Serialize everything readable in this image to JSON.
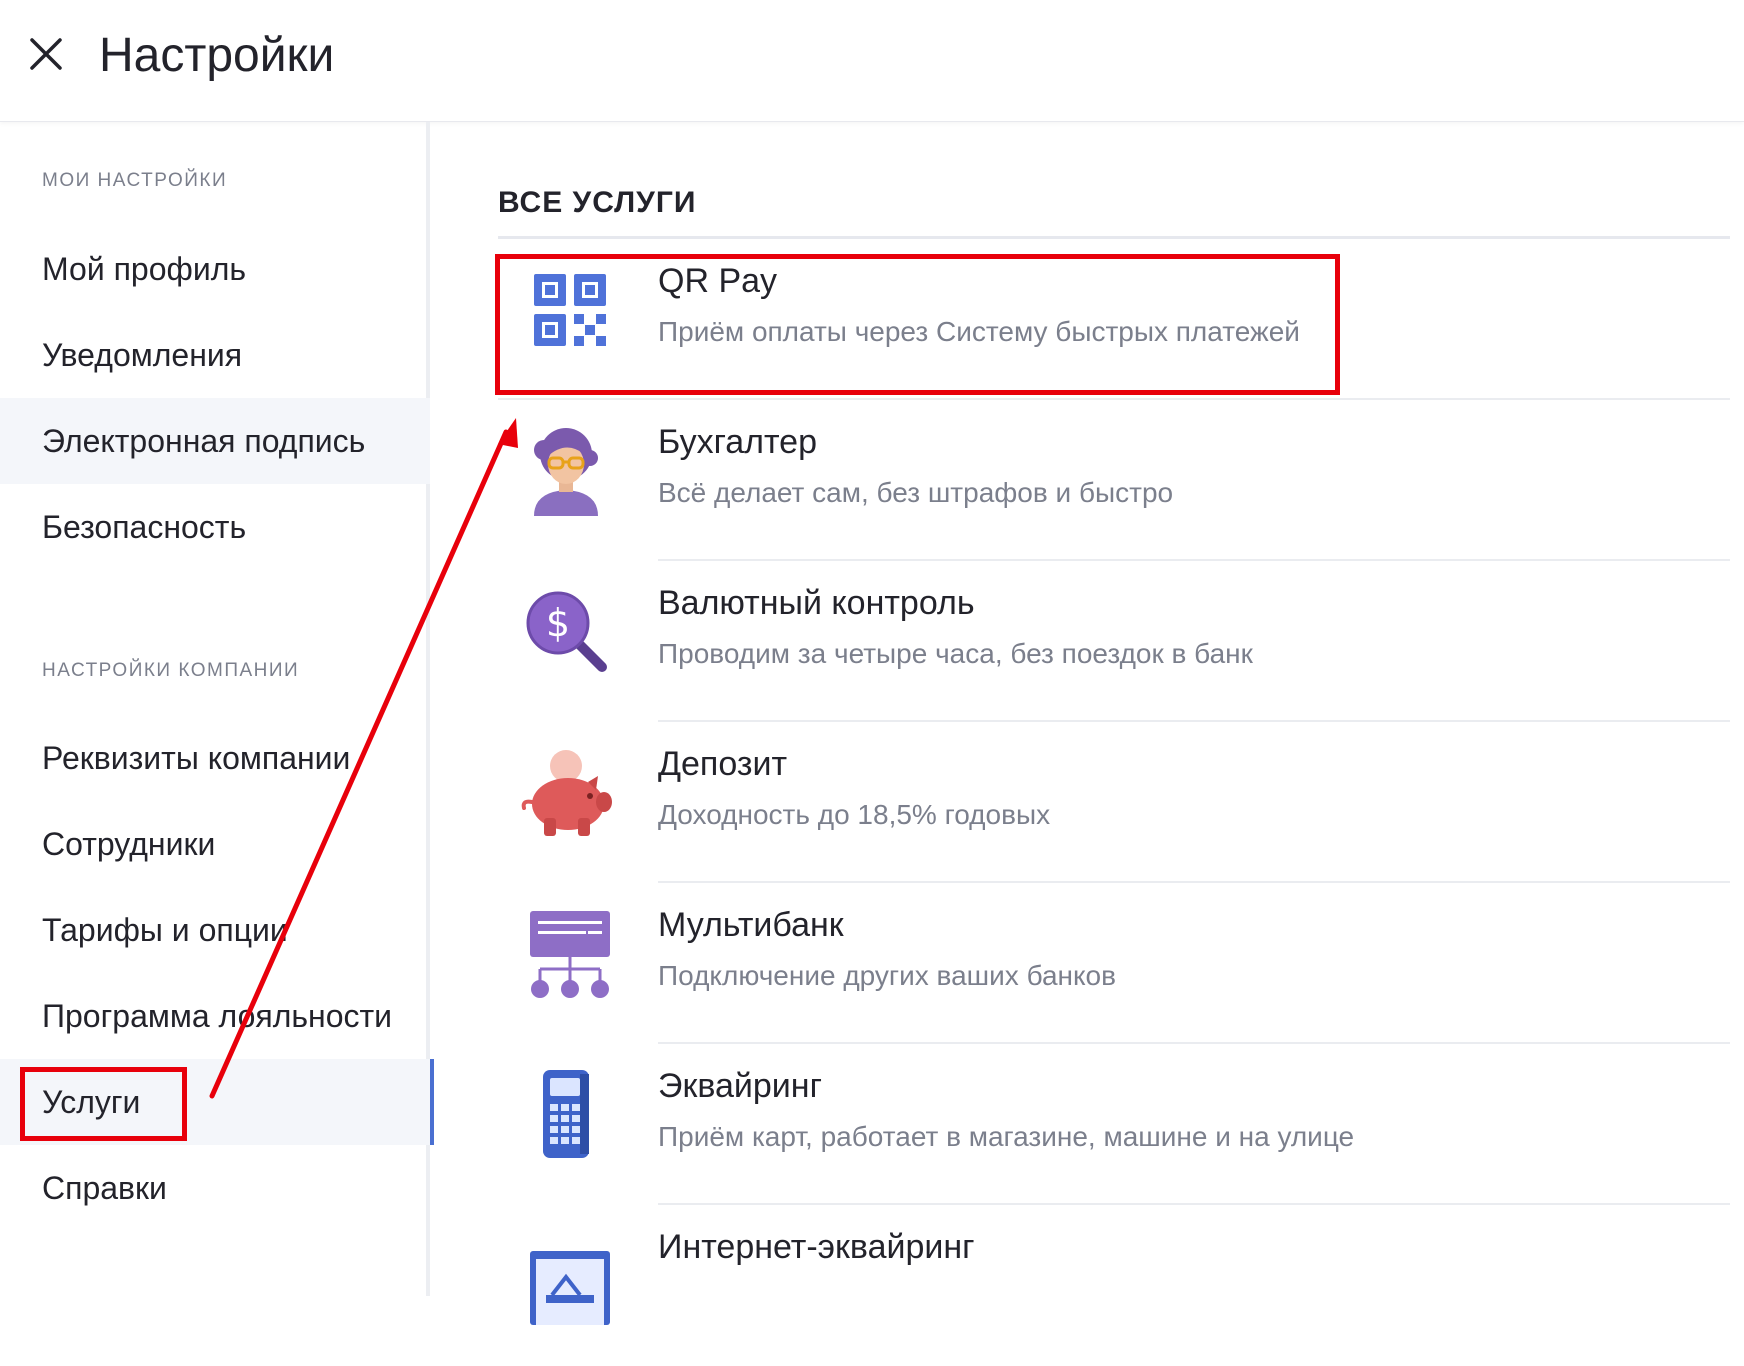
{
  "header": {
    "title": "Настройки"
  },
  "sidebar": {
    "my_section_label": "МОИ НАСТРОЙКИ",
    "my_items": [
      {
        "label": "Мой профиль"
      },
      {
        "label": "Уведомления"
      },
      {
        "label": "Электронная подпись"
      },
      {
        "label": "Безопасность"
      }
    ],
    "company_section_label": "НАСТРОЙКИ КОМПАНИИ",
    "company_items": [
      {
        "label": "Реквизиты компании"
      },
      {
        "label": "Сотрудники"
      },
      {
        "label": "Тарифы и опции"
      },
      {
        "label": "Программа лояльности"
      },
      {
        "label": "Услуги"
      },
      {
        "label": "Справки"
      }
    ]
  },
  "main": {
    "title": "ВСЕ УСЛУГИ",
    "services": [
      {
        "name": "QR Pay",
        "desc": "Приём оплаты через Систему быстрых платежей",
        "icon": "qr-code-icon"
      },
      {
        "name": "Бухгалтер",
        "desc": "Всё делает сам, без штрафов и быстро",
        "icon": "accountant-icon"
      },
      {
        "name": "Валютный контроль",
        "desc": "Проводим за четыре часа, без поездок в банк",
        "icon": "currency-search-icon"
      },
      {
        "name": "Депозит",
        "desc": "Доходность до 18,5% годовых",
        "icon": "piggy-bank-icon"
      },
      {
        "name": "Мультибанк",
        "desc": "Подключение других ваших банков",
        "icon": "multibank-icon"
      },
      {
        "name": "Эквайринг",
        "desc": "Приём карт, работает в магазине, машине и на улице",
        "icon": "pos-terminal-icon"
      },
      {
        "name": "Интернет-эквайринг",
        "desc": "",
        "icon": "internet-acquiring-icon"
      }
    ]
  },
  "colors": {
    "accent": "#4a6fd1",
    "annotation": "#e8000b",
    "text": "#23232b",
    "muted": "#7b7f8c"
  }
}
